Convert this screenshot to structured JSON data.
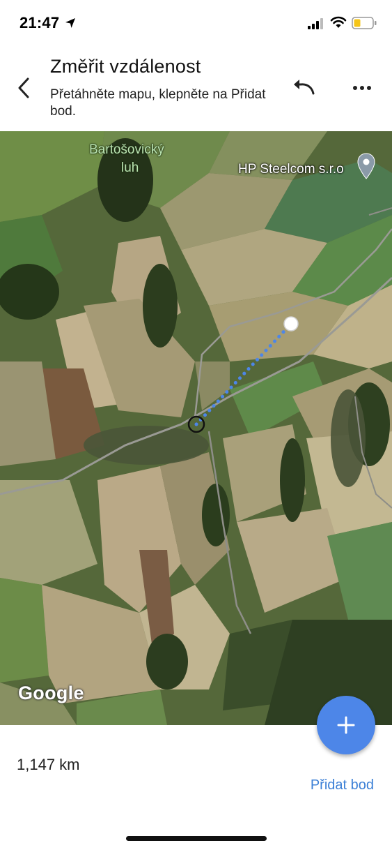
{
  "status_bar": {
    "time": "21:47",
    "icons": [
      "location-arrow-icon",
      "cellular-signal-icon",
      "wifi-icon",
      "battery-icon"
    ],
    "battery_color": "#f5c518"
  },
  "header": {
    "title": "Změřit vzdálenost",
    "subtitle": "Přetáhněte mapu, klepněte na Přidat bod.",
    "back_icon": "chevron-left-icon",
    "undo_icon": "undo-icon",
    "more_icon": "more-horizontal-icon"
  },
  "map": {
    "place_label_line1": "Bartošovický",
    "place_label_line2": "luh",
    "poi_label": "HP Steelcom s.r.o",
    "poi_icon": "map-pin-icon",
    "logo": "Google",
    "measure_line_color": "#4d86e8"
  },
  "bottom": {
    "distance": "1,147 km",
    "add_point_label": "Přidat bod",
    "fab_icon": "plus-icon",
    "accent_color": "#4d86e8"
  }
}
